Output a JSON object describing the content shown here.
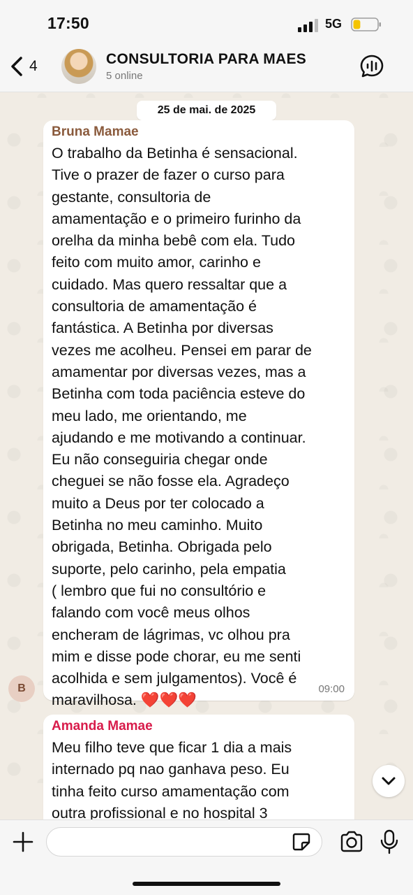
{
  "status_bar": {
    "time": "17:50",
    "network": "5G",
    "battery_level": 0.3,
    "battery_color": "#f5c400",
    "signal_bars": 3
  },
  "header": {
    "back_count": "4",
    "title": "CONSULTORIA PARA MAES",
    "subtitle": "5 online",
    "back_icon": "chevron-left-icon",
    "call_icon": "audio-call-icon"
  },
  "chat": {
    "date_chip": "25 de mai. de 2025",
    "messages": [
      {
        "sender": "Bruna Mamae",
        "sender_color": "#8a5a3c",
        "avatar_initial": "B",
        "text": "O trabalho da Betinha é sensacional.\nTive o prazer de fazer o curso para\ngestante, consultoria de\namamentação e o primeiro furinho da\norelha da minha bebê com ela. Tudo\nfeito com muito amor, carinho e\ncuidado. Mas quero ressaltar que a\nconsultoria de amamentação é\nfantástica. A Betinha por diversas\nvezes me acolheu. Pensei em parar de\namamentar por diversas vezes, mas a\nBetinha com toda paciência esteve do\nmeu lado, me orientando, me\najudando e me motivando a continuar.\nEu não conseguiria chegar onde\ncheguei se não fosse ela. Agradeço\nmuito a Deus por ter colocado a\nBetinha no meu caminho.  Muito\nobrigada, Betinha. Obrigada pelo\nsuporte, pelo carinho, pela empatia\n( lembro que fui no consultório e\nfalando com você meus olhos\nencheram de lágrimas, vc olhou pra\nmim e disse pode chorar, eu me senti\nacolhida e sem julgamentos). Você é\nmaravilhosa. ❤️❤️❤️",
        "time": "09:00"
      },
      {
        "sender": "Amanda Mamae",
        "sender_color": "#d81b4a",
        "text": "Meu filho teve que ficar 1 dia a mais\ninternado pq nao ganhava peso. Eu\ntinha feito curso amamentação com\noutra profissional e no hospital 3"
      }
    ]
  },
  "composer": {
    "input_value": "",
    "attach_icon": "plus-icon",
    "sticker_icon": "sticker-icon",
    "camera_icon": "camera-icon",
    "mic_icon": "microphone-icon"
  },
  "scroll_icon": "chevron-down-icon"
}
